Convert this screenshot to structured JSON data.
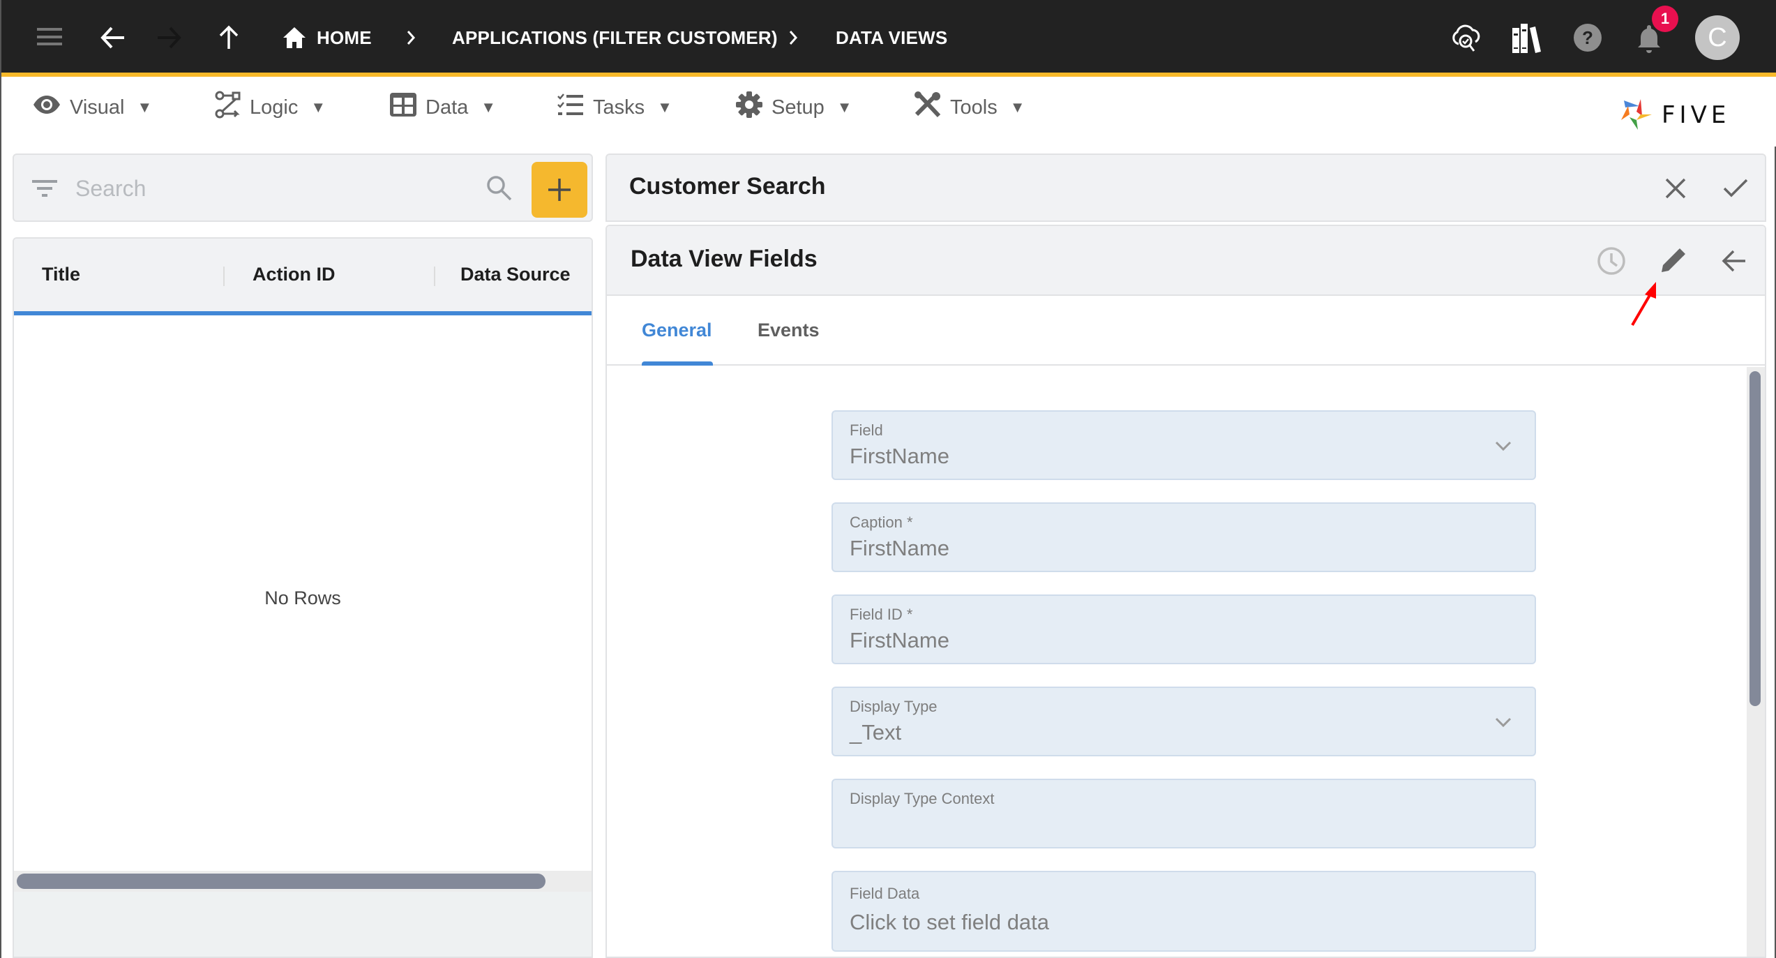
{
  "header": {
    "breadcrumbs": [
      {
        "label": "HOME",
        "icon": "home-icon"
      },
      {
        "label": "APPLICATIONS (FILTER CUSTOMER)"
      },
      {
        "label": "DATA VIEWS"
      }
    ],
    "nav_icons": [
      "menu-icon",
      "back-arrow-icon",
      "forward-arrow-icon",
      "up-arrow-icon"
    ],
    "right_icons": [
      "cloud-search-icon",
      "library-books-icon",
      "help-icon",
      "notifications-bell-icon"
    ],
    "notification_count": "1",
    "avatar_initial": "C"
  },
  "menu": {
    "items": [
      {
        "label": "Visual",
        "icon": "eye-icon"
      },
      {
        "label": "Logic",
        "icon": "logic-flow-icon"
      },
      {
        "label": "Data",
        "icon": "table-grid-icon"
      },
      {
        "label": "Tasks",
        "icon": "checklist-icon"
      },
      {
        "label": "Setup",
        "icon": "gear-icon"
      },
      {
        "label": "Tools",
        "icon": "tools-icon"
      }
    ],
    "caret": "▼",
    "logo_text": "FIVE"
  },
  "left_panel": {
    "search": {
      "placeholder": "Search",
      "value": ""
    },
    "add_label": "+",
    "columns": [
      "Title",
      "Action ID",
      "Data Source"
    ],
    "empty_text": "No Rows"
  },
  "right_panel": {
    "title": "Customer Search",
    "sub_title": "Data View Fields",
    "tabs": [
      {
        "label": "General",
        "active": true
      },
      {
        "label": "Events",
        "active": false
      }
    ],
    "fields": [
      {
        "label": "Field",
        "value": "FirstName",
        "type": "select"
      },
      {
        "label": "Caption *",
        "value": "FirstName",
        "type": "text"
      },
      {
        "label": "Field ID *",
        "value": "FirstName",
        "type": "text"
      },
      {
        "label": "Display Type",
        "value": "_Text",
        "type": "select"
      },
      {
        "label": "Display Type Context",
        "value": "",
        "type": "text"
      },
      {
        "label": "Field Data",
        "value": "Click to set field data",
        "type": "button"
      }
    ]
  },
  "colors": {
    "header_bg": "#222222",
    "accent_yellow": "#f8b92a",
    "tab_active": "#4187d6",
    "tab_inactive": "#5f5f5f",
    "badge": "#e8104f",
    "annotation_arrow": "#ff0000"
  }
}
